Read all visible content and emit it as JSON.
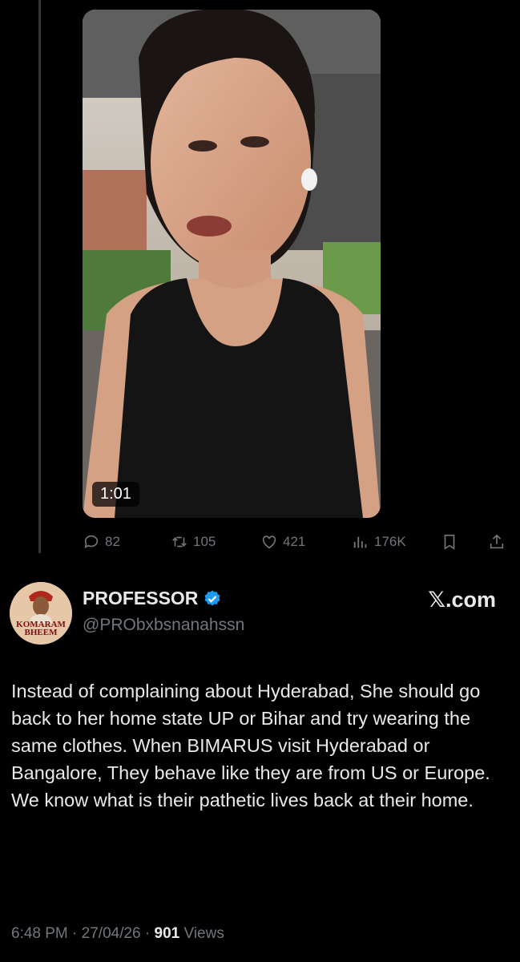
{
  "video": {
    "duration": "1:01"
  },
  "actions": {
    "replies": "82",
    "reposts": "105",
    "likes": "421",
    "views": "176K"
  },
  "quoted_tweet": {
    "display_name": "PROFESSOR",
    "handle": "@PRObxbsnanahssn",
    "avatar_text_line1": "KOMARAM",
    "avatar_text_line2": "BHEEM",
    "site": "𝕏.com",
    "verified_color": "#1d9bf0",
    "text": "Instead of complaining about Hyderabad, She should go back to her home state UP or Bihar and try wearing the same clothes. When BIMARUS visit Hyderabad or Bangalore, They behave like they are from US or Europe. We know what is their pathetic lives back at their home.",
    "time": "6:48 PM",
    "date": "27/04/26",
    "views_count": "901",
    "views_label": "Views"
  },
  "icons": [
    "reply-icon",
    "repost-icon",
    "like-icon",
    "views-icon",
    "bookmark-icon",
    "share-icon",
    "verified-icon"
  ]
}
